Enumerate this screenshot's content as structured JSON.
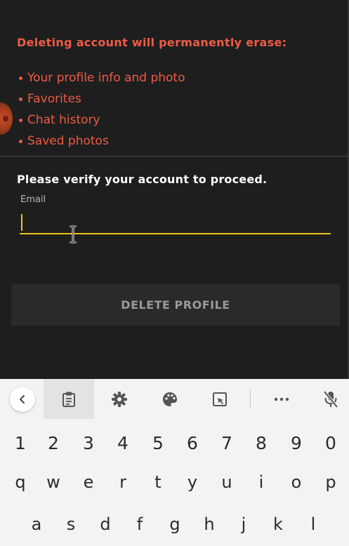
{
  "warning": {
    "title": "Deleting account will permanently erase:",
    "items": [
      "Your profile info and photo",
      "Favorites",
      "Chat history",
      "Saved photos"
    ],
    "accent_color": "#ee5b45"
  },
  "verify": {
    "title": "Please verify your account to proceed.",
    "email_label": "Email",
    "email_value": "",
    "field_accent_color": "#f1c21b"
  },
  "delete_button": {
    "label": "DELETE PROFILE"
  },
  "keyboard": {
    "toolbar": [
      "back-icon",
      "clipboard-icon",
      "gear-icon",
      "palette-icon",
      "screenshot-edit-icon",
      "more-icon",
      "mic-off-icon"
    ],
    "number_row": [
      "1",
      "2",
      "3",
      "4",
      "5",
      "6",
      "7",
      "8",
      "9",
      "0"
    ],
    "row_qwerty": [
      "q",
      "w",
      "e",
      "r",
      "t",
      "y",
      "u",
      "i",
      "o",
      "p"
    ],
    "row_asdf": [
      "a",
      "s",
      "d",
      "f",
      "g",
      "h",
      "j",
      "k",
      "l"
    ]
  }
}
